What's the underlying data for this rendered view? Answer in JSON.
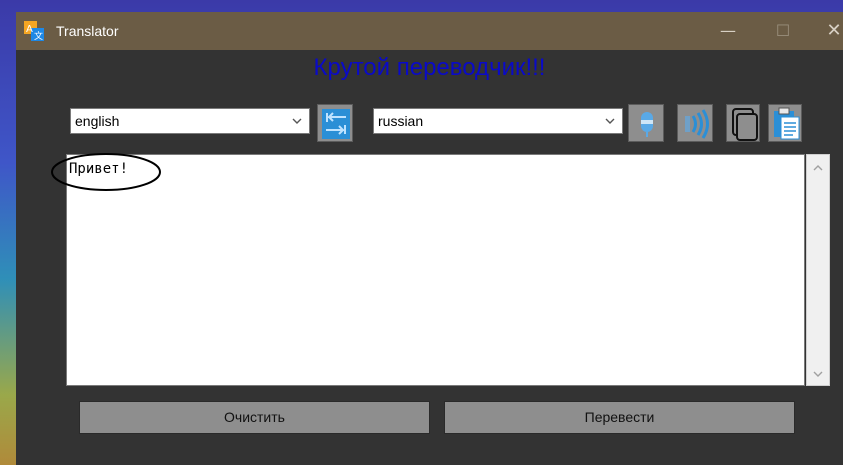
{
  "window": {
    "title": "Translator",
    "minimize_glyph": "—",
    "maximize_glyph": "☐",
    "close_glyph": "✕"
  },
  "heading": "Крутой переводчик!!!",
  "languages": {
    "source": "english",
    "target": "russian"
  },
  "input": {
    "text": "Привет!"
  },
  "buttons": {
    "clear": "Очистить",
    "translate": "Перевести"
  },
  "icons": {
    "app": "translator-app-icon",
    "swap": "swap-languages-icon",
    "mic": "microphone-icon",
    "speaker": "speaker-icon",
    "copy": "copy-icon",
    "paste": "clipboard-paste-icon"
  },
  "colors": {
    "titlebar": "#6b5c45",
    "window_bg": "#333333",
    "heading": "#0a0ac8",
    "button_bg": "#8e8e8e",
    "icon_blue": "#1e88e5"
  }
}
